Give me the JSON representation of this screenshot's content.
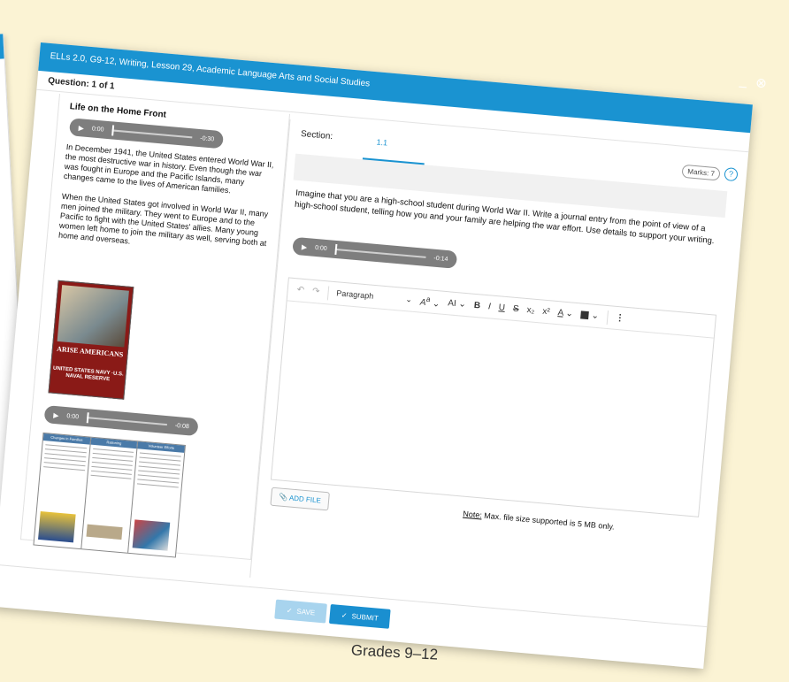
{
  "window": {
    "title": "ELLs 2.0, G9-12, Writing, Lesson 29, Academic Language Arts and Social Studies",
    "question_label": "Question:",
    "question_value": "1 of 1",
    "minimize_glyph": "_",
    "close_glyph": "⊗",
    "marks": "Marks: 7",
    "help_glyph": "?"
  },
  "left_panel": {
    "title": "Life on the Home Front",
    "audio1": {
      "current": "0:00",
      "remaining": "-0:30"
    },
    "paragraph1": "In December 1941, the United States entered World War II, the most destructive war in history. Even though the war was fought in Europe and the Pacific Islands, many changes came to the lives of American families.",
    "paragraph2": "When the United States got involved in World War II, many men joined the military. They went to Europe and to the Pacific to fight with the United States' allies. Many young women left home to join the military as well, serving both at home and overseas.",
    "poster": {
      "headline": "ARISE AMERICANS",
      "footer": "UNITED STATES NAVY ·U.S. NAVAL RESERVE"
    },
    "audio2": {
      "current": "0:00",
      "remaining": "-0:08"
    },
    "table_headers": [
      "Changes in Families",
      "Rationing",
      "Volunteer Efforts"
    ]
  },
  "right_panel": {
    "section_label": "Section:",
    "section_tab": "1.1",
    "prompt": "Imagine that you are a high-school student during World War II. Write a journal entry from the point of view of a high-school student, telling how you and your family are helping the war effort. Use details to support your writing.",
    "audio": {
      "current": "0:00",
      "remaining": "-0:14"
    },
    "toolbar": {
      "undo": "↶",
      "redo": "↷",
      "paragraph": "Paragraph",
      "chevron": "⌄",
      "font_size": "A",
      "font_size_sup": "a",
      "text_case": "AI",
      "bold": "B",
      "italic": "I",
      "underline": "U",
      "strike": "S",
      "subscript": "x₂",
      "superscript": "x²",
      "text_color": "A",
      "highlight": "A",
      "more": "⋮"
    },
    "add_file": "ADD FILE",
    "note_label": "Note:",
    "note_text": " Max. file size supported is 5 MB only."
  },
  "footer": {
    "save": "SAVE",
    "submit": "SUBMIT",
    "check": "✓"
  },
  "caption": "Grades 9–12"
}
